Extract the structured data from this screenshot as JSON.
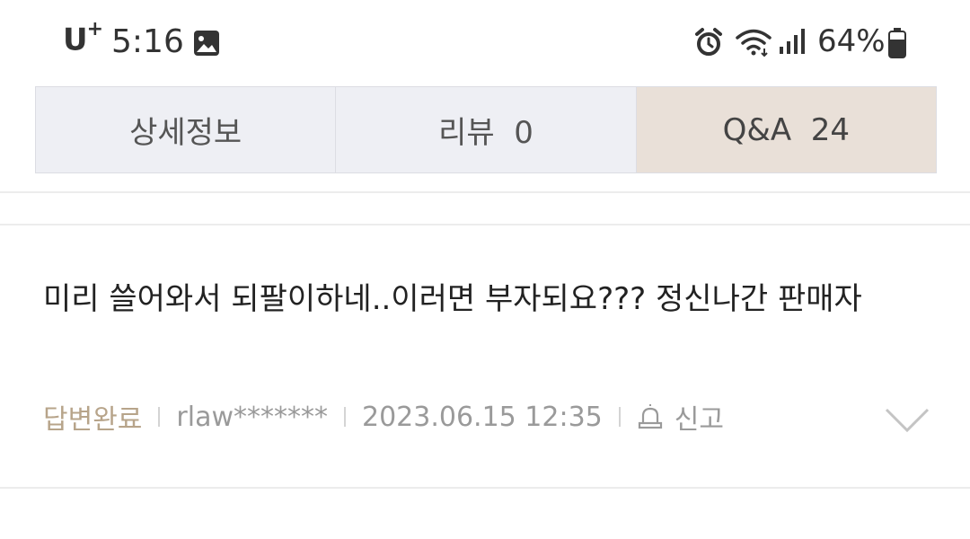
{
  "status_bar": {
    "carrier": "U",
    "carrier_plus": "+",
    "time": "5:16",
    "battery_percent": "64%",
    "icons": [
      "gallery-icon",
      "alarm-icon",
      "wifi-icon",
      "signal-icon",
      "battery-icon"
    ]
  },
  "tabs": [
    {
      "label": "상세정보",
      "active": false
    },
    {
      "label": "리뷰  0",
      "active": false
    },
    {
      "label": "Q&A  24",
      "active": true
    }
  ],
  "qa_item": {
    "question": "미리 쓸어와서 되팔이하네..이러면 부자되요??? 정신나간 판매자",
    "status": "답변완료",
    "author": "rlaw*******",
    "datetime": "2023.06.15 12:35",
    "report_label": "신고"
  },
  "colors": {
    "tab_bg": "#eeeff4",
    "tab_active_bg": "#e9e0d8",
    "status_answered": "#b7a48a",
    "meta_text": "#9a9a9a"
  }
}
